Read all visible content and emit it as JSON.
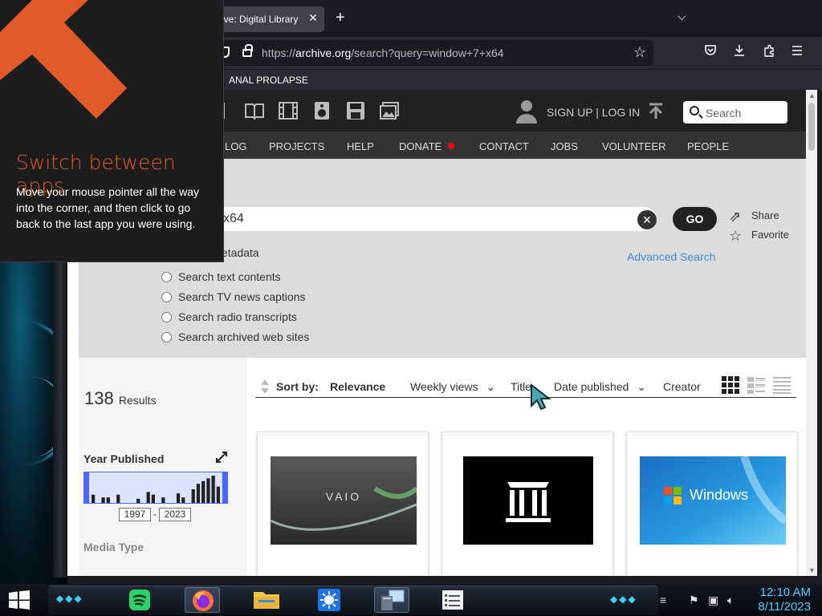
{
  "browser": {
    "tab_title": "ive: Digital Library",
    "tab_close": "✕",
    "new_tab": "+",
    "tab_list": "⌵",
    "url_prefix": "https://",
    "url_domain": "archive.org",
    "url_path": "/search?query=window+7+x64",
    "bookmark": "ANAL PROLAPSE"
  },
  "ia_header": {
    "signup_login": "SIGN UP | LOG IN",
    "search_placeholder": "Search",
    "nav_items": [
      "LOG",
      "PROJECTS",
      "HELP",
      "DONATE",
      "CONTACT",
      "JOBS",
      "VOLUNTEER",
      "PEOPLE"
    ]
  },
  "search": {
    "query_visible": "x64",
    "clear": "✕",
    "go": "GO",
    "share": "Share",
    "favorite": "Favorite",
    "advanced": "Advanced Search",
    "metadata_option": "etadata",
    "options": [
      "Search text contents",
      "Search TV news captions",
      "Search radio transcripts",
      "Search archived web sites"
    ]
  },
  "results": {
    "count": "138",
    "count_label": "Results",
    "year_title": "Year Published",
    "year_from": "1997",
    "year_to": "2023",
    "year_dash": "-",
    "media_type": "Media Type",
    "histogram": [
      0.3,
      0,
      0.2,
      0.2,
      0,
      0.3,
      0,
      0,
      0,
      0.15,
      0,
      0.4,
      0.3,
      0,
      0.2,
      0,
      0,
      0.35,
      0.2,
      0,
      0.5,
      0.7,
      0.8,
      0.9,
      1.0,
      0.6
    ],
    "sort_label": "Sort by:",
    "sort_options": [
      "Relevance",
      "Weekly views",
      "Title",
      "Date published",
      "Creator"
    ],
    "tiles": [
      {
        "thumb": "vaio-wallpaper",
        "brand": "VAIO"
      },
      {
        "thumb": "internet-archive-logo"
      },
      {
        "thumb": "windows7-logo",
        "brand": "Windows"
      }
    ]
  },
  "tip": {
    "title": "Switch between apps",
    "body": "Move your mouse pointer all the way into the corner, and then click to go back to the last app you were using."
  },
  "taskbar": {
    "time": "12:10 AM",
    "date": "8/11/2023",
    "apps": [
      "spotify-icon",
      "firefox-icon",
      "file-explorer-icon",
      "weather-icon",
      "remote-desktop-icon",
      "list-icon"
    ]
  },
  "colors": {
    "tip_accent": "#e05a2a",
    "clock": "#4ed1ff",
    "ia_link": "#428bca"
  }
}
